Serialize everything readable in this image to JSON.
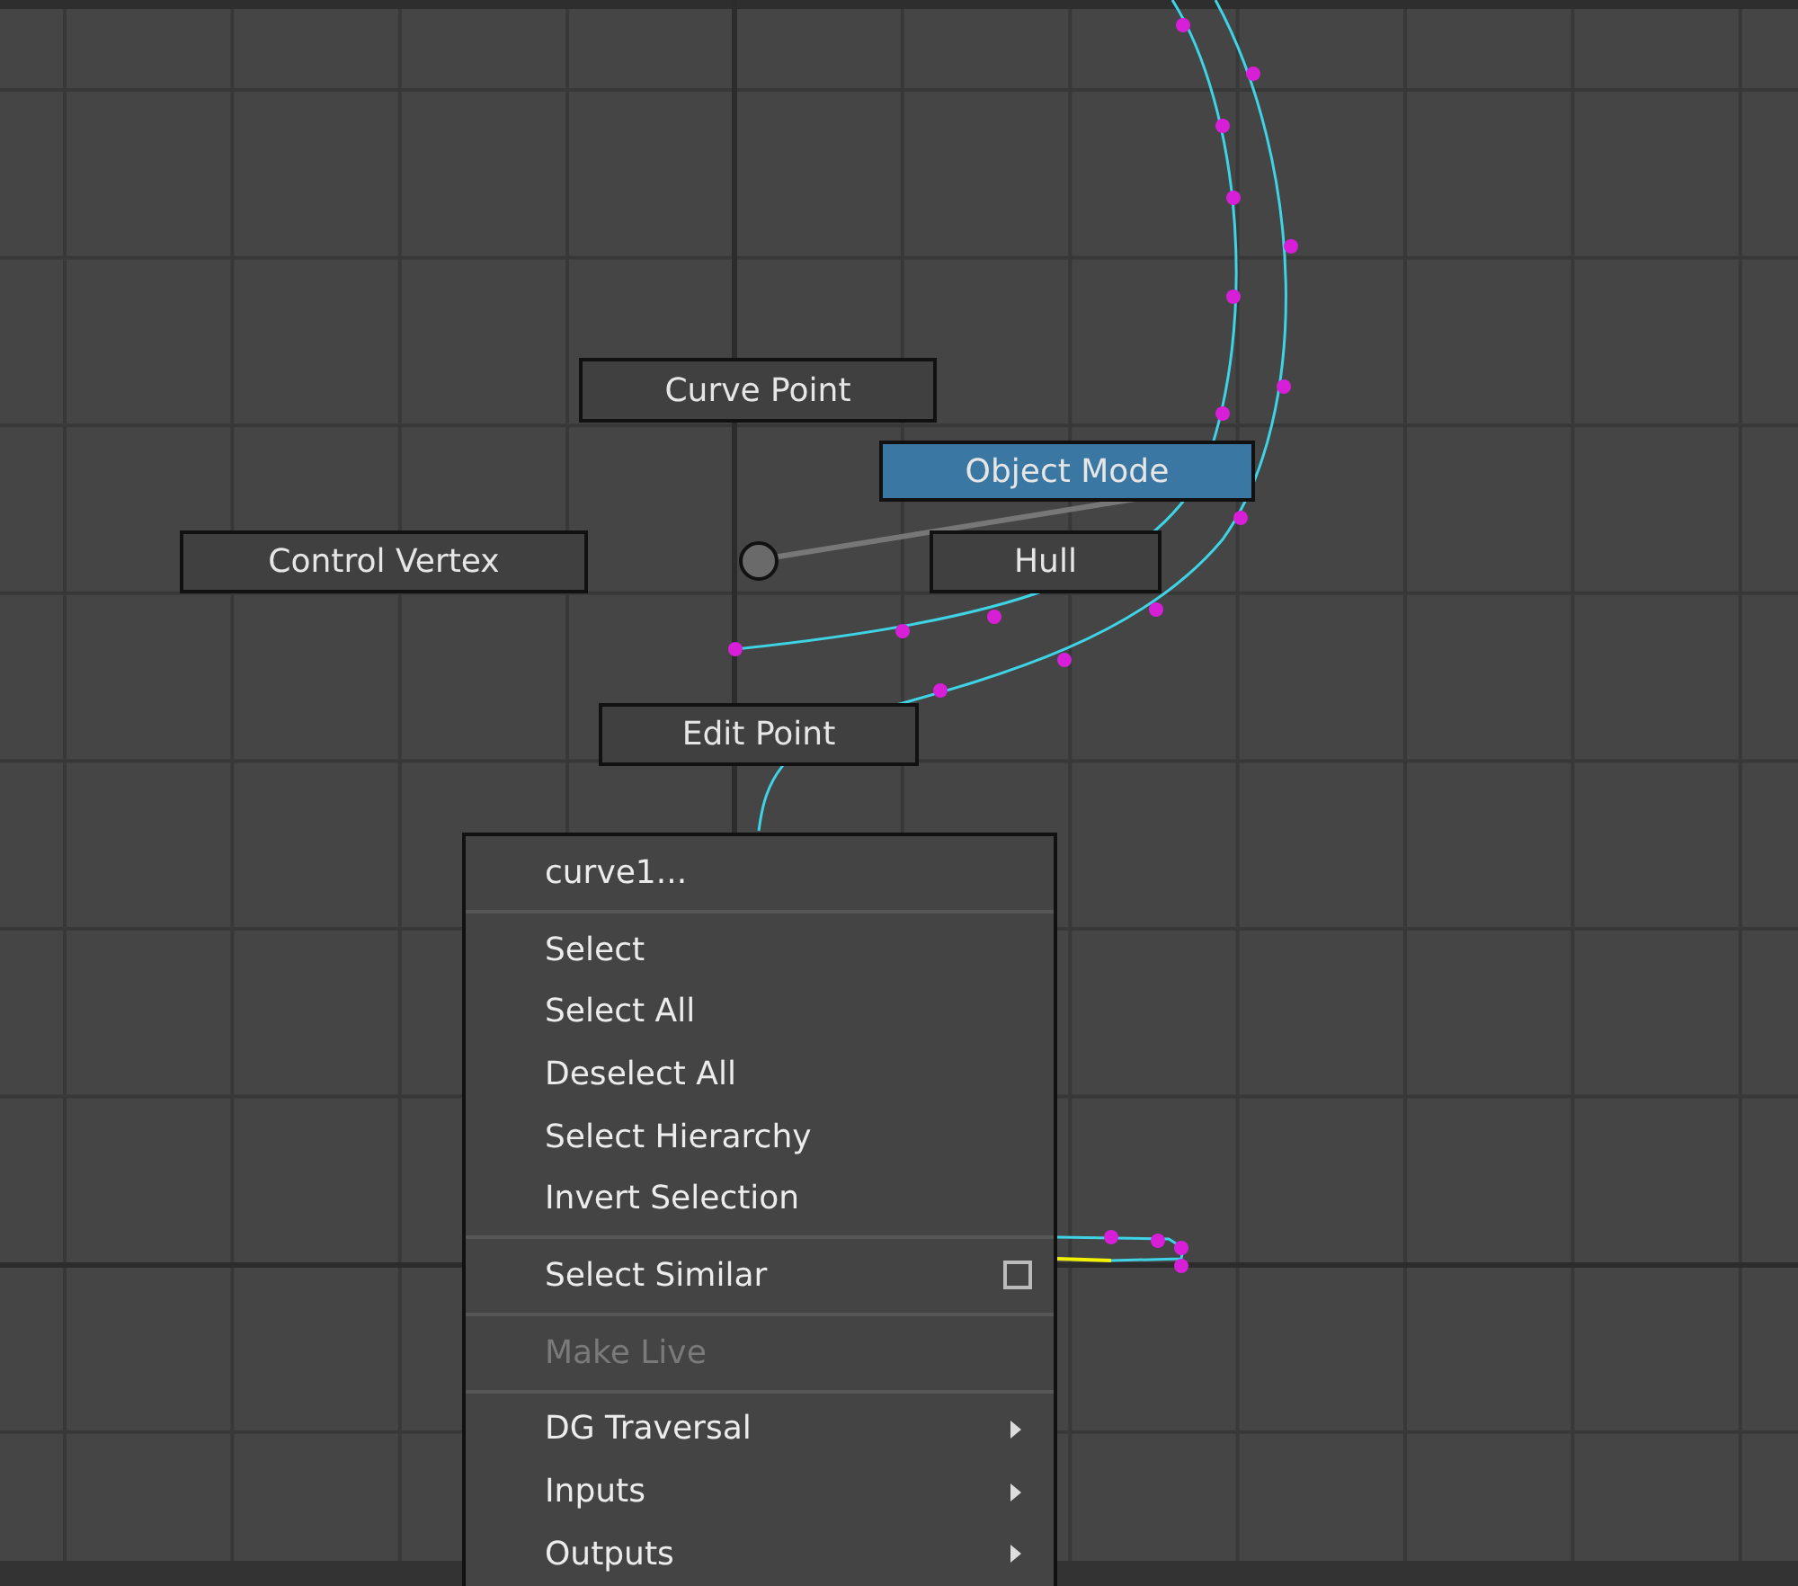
{
  "marking_menu": {
    "items": [
      {
        "label": "Curve Point",
        "selected": false
      },
      {
        "label": "Object Mode",
        "selected": true
      },
      {
        "label": "Control Vertex",
        "selected": false
      },
      {
        "label": "Hull",
        "selected": false
      },
      {
        "label": "Edit Point",
        "selected": false
      }
    ]
  },
  "context_menu": {
    "items": [
      {
        "kind": "header",
        "label": "curve1...",
        "disabled": false
      },
      {
        "kind": "separator"
      },
      {
        "kind": "item",
        "label": "Select",
        "disabled": false
      },
      {
        "kind": "item",
        "label": "Select All",
        "disabled": false
      },
      {
        "kind": "item",
        "label": "Deselect All",
        "disabled": false
      },
      {
        "kind": "item",
        "label": "Select Hierarchy",
        "disabled": false
      },
      {
        "kind": "item",
        "label": "Invert Selection",
        "disabled": false
      },
      {
        "kind": "separator"
      },
      {
        "kind": "checkbox",
        "label": "Select Similar",
        "disabled": false,
        "checked": false
      },
      {
        "kind": "separator"
      },
      {
        "kind": "item",
        "label": "Make Live",
        "disabled": true
      },
      {
        "kind": "separator"
      },
      {
        "kind": "submenu",
        "label": "DG Traversal",
        "disabled": false
      },
      {
        "kind": "submenu",
        "label": "Inputs",
        "disabled": false
      },
      {
        "kind": "submenu",
        "label": "Outputs",
        "disabled": false
      }
    ]
  }
}
